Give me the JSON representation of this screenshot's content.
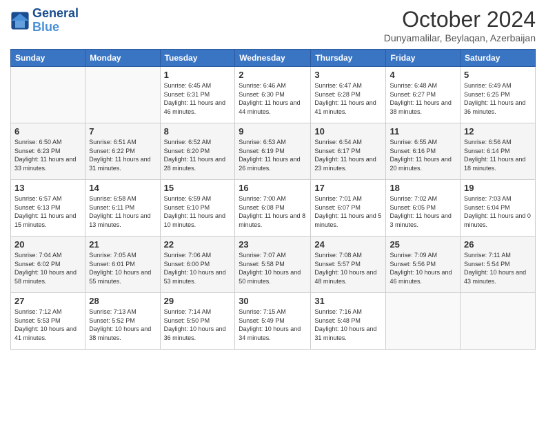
{
  "header": {
    "logo_line1": "General",
    "logo_line2": "Blue",
    "month_title": "October 2024",
    "location": "Dunyamalilar, Beylaqan, Azerbaijan"
  },
  "days_of_week": [
    "Sunday",
    "Monday",
    "Tuesday",
    "Wednesday",
    "Thursday",
    "Friday",
    "Saturday"
  ],
  "weeks": [
    [
      {
        "day": "",
        "detail": ""
      },
      {
        "day": "",
        "detail": ""
      },
      {
        "day": "1",
        "detail": "Sunrise: 6:45 AM\nSunset: 6:31 PM\nDaylight: 11 hours and 46 minutes."
      },
      {
        "day": "2",
        "detail": "Sunrise: 6:46 AM\nSunset: 6:30 PM\nDaylight: 11 hours and 44 minutes."
      },
      {
        "day": "3",
        "detail": "Sunrise: 6:47 AM\nSunset: 6:28 PM\nDaylight: 11 hours and 41 minutes."
      },
      {
        "day": "4",
        "detail": "Sunrise: 6:48 AM\nSunset: 6:27 PM\nDaylight: 11 hours and 38 minutes."
      },
      {
        "day": "5",
        "detail": "Sunrise: 6:49 AM\nSunset: 6:25 PM\nDaylight: 11 hours and 36 minutes."
      }
    ],
    [
      {
        "day": "6",
        "detail": "Sunrise: 6:50 AM\nSunset: 6:23 PM\nDaylight: 11 hours and 33 minutes."
      },
      {
        "day": "7",
        "detail": "Sunrise: 6:51 AM\nSunset: 6:22 PM\nDaylight: 11 hours and 31 minutes."
      },
      {
        "day": "8",
        "detail": "Sunrise: 6:52 AM\nSunset: 6:20 PM\nDaylight: 11 hours and 28 minutes."
      },
      {
        "day": "9",
        "detail": "Sunrise: 6:53 AM\nSunset: 6:19 PM\nDaylight: 11 hours and 26 minutes."
      },
      {
        "day": "10",
        "detail": "Sunrise: 6:54 AM\nSunset: 6:17 PM\nDaylight: 11 hours and 23 minutes."
      },
      {
        "day": "11",
        "detail": "Sunrise: 6:55 AM\nSunset: 6:16 PM\nDaylight: 11 hours and 20 minutes."
      },
      {
        "day": "12",
        "detail": "Sunrise: 6:56 AM\nSunset: 6:14 PM\nDaylight: 11 hours and 18 minutes."
      }
    ],
    [
      {
        "day": "13",
        "detail": "Sunrise: 6:57 AM\nSunset: 6:13 PM\nDaylight: 11 hours and 15 minutes."
      },
      {
        "day": "14",
        "detail": "Sunrise: 6:58 AM\nSunset: 6:11 PM\nDaylight: 11 hours and 13 minutes."
      },
      {
        "day": "15",
        "detail": "Sunrise: 6:59 AM\nSunset: 6:10 PM\nDaylight: 11 hours and 10 minutes."
      },
      {
        "day": "16",
        "detail": "Sunrise: 7:00 AM\nSunset: 6:08 PM\nDaylight: 11 hours and 8 minutes."
      },
      {
        "day": "17",
        "detail": "Sunrise: 7:01 AM\nSunset: 6:07 PM\nDaylight: 11 hours and 5 minutes."
      },
      {
        "day": "18",
        "detail": "Sunrise: 7:02 AM\nSunset: 6:05 PM\nDaylight: 11 hours and 3 minutes."
      },
      {
        "day": "19",
        "detail": "Sunrise: 7:03 AM\nSunset: 6:04 PM\nDaylight: 11 hours and 0 minutes."
      }
    ],
    [
      {
        "day": "20",
        "detail": "Sunrise: 7:04 AM\nSunset: 6:02 PM\nDaylight: 10 hours and 58 minutes."
      },
      {
        "day": "21",
        "detail": "Sunrise: 7:05 AM\nSunset: 6:01 PM\nDaylight: 10 hours and 55 minutes."
      },
      {
        "day": "22",
        "detail": "Sunrise: 7:06 AM\nSunset: 6:00 PM\nDaylight: 10 hours and 53 minutes."
      },
      {
        "day": "23",
        "detail": "Sunrise: 7:07 AM\nSunset: 5:58 PM\nDaylight: 10 hours and 50 minutes."
      },
      {
        "day": "24",
        "detail": "Sunrise: 7:08 AM\nSunset: 5:57 PM\nDaylight: 10 hours and 48 minutes."
      },
      {
        "day": "25",
        "detail": "Sunrise: 7:09 AM\nSunset: 5:56 PM\nDaylight: 10 hours and 46 minutes."
      },
      {
        "day": "26",
        "detail": "Sunrise: 7:11 AM\nSunset: 5:54 PM\nDaylight: 10 hours and 43 minutes."
      }
    ],
    [
      {
        "day": "27",
        "detail": "Sunrise: 7:12 AM\nSunset: 5:53 PM\nDaylight: 10 hours and 41 minutes."
      },
      {
        "day": "28",
        "detail": "Sunrise: 7:13 AM\nSunset: 5:52 PM\nDaylight: 10 hours and 38 minutes."
      },
      {
        "day": "29",
        "detail": "Sunrise: 7:14 AM\nSunset: 5:50 PM\nDaylight: 10 hours and 36 minutes."
      },
      {
        "day": "30",
        "detail": "Sunrise: 7:15 AM\nSunset: 5:49 PM\nDaylight: 10 hours and 34 minutes."
      },
      {
        "day": "31",
        "detail": "Sunrise: 7:16 AM\nSunset: 5:48 PM\nDaylight: 10 hours and 31 minutes."
      },
      {
        "day": "",
        "detail": ""
      },
      {
        "day": "",
        "detail": ""
      }
    ]
  ]
}
